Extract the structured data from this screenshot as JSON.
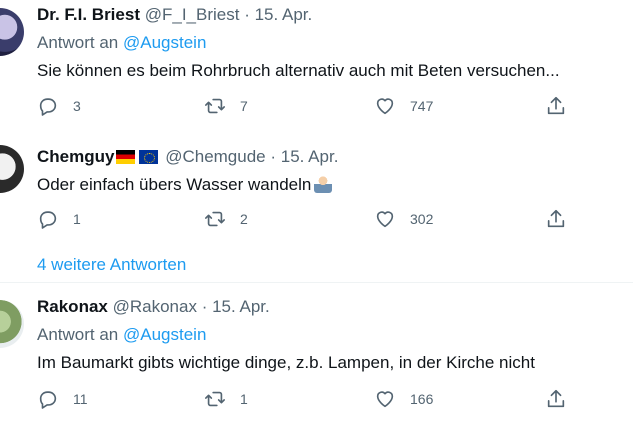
{
  "tweets": [
    {
      "name": "Dr. F.I. Briest",
      "handle": "@F_I_Briest",
      "date": "· 15. Apr.",
      "reply_prefix": "Antwort an",
      "reply_to": "@Augstein",
      "text": "Sie können es beim Rohrbruch alternativ auch mit Beten versuchen...",
      "replies": "3",
      "retweets": "7",
      "likes": "747"
    },
    {
      "name": "Chemguy",
      "handle": "@Chemgude",
      "date": "· 15. Apr.",
      "flags": [
        "german-flag-icon",
        "eu-flag-icon"
      ],
      "text": "Oder einfach übers Wasser wandeln",
      "replies": "1",
      "retweets": "2",
      "likes": "302"
    },
    {
      "name": "Rakonax",
      "handle": "@Rakonax",
      "date": "· 15. Apr.",
      "reply_prefix": "Antwort an",
      "reply_to": "@Augstein",
      "text": "Im Baumarkt gibts wichtige dinge, z.b. Lampen, in der Kirche nicht",
      "replies": "11",
      "retweets": "1",
      "likes": "166"
    }
  ],
  "more_replies": "4 weitere Antworten",
  "colors": {
    "link": "#1d9bf0",
    "muted": "#536471",
    "text": "#0f1419"
  }
}
